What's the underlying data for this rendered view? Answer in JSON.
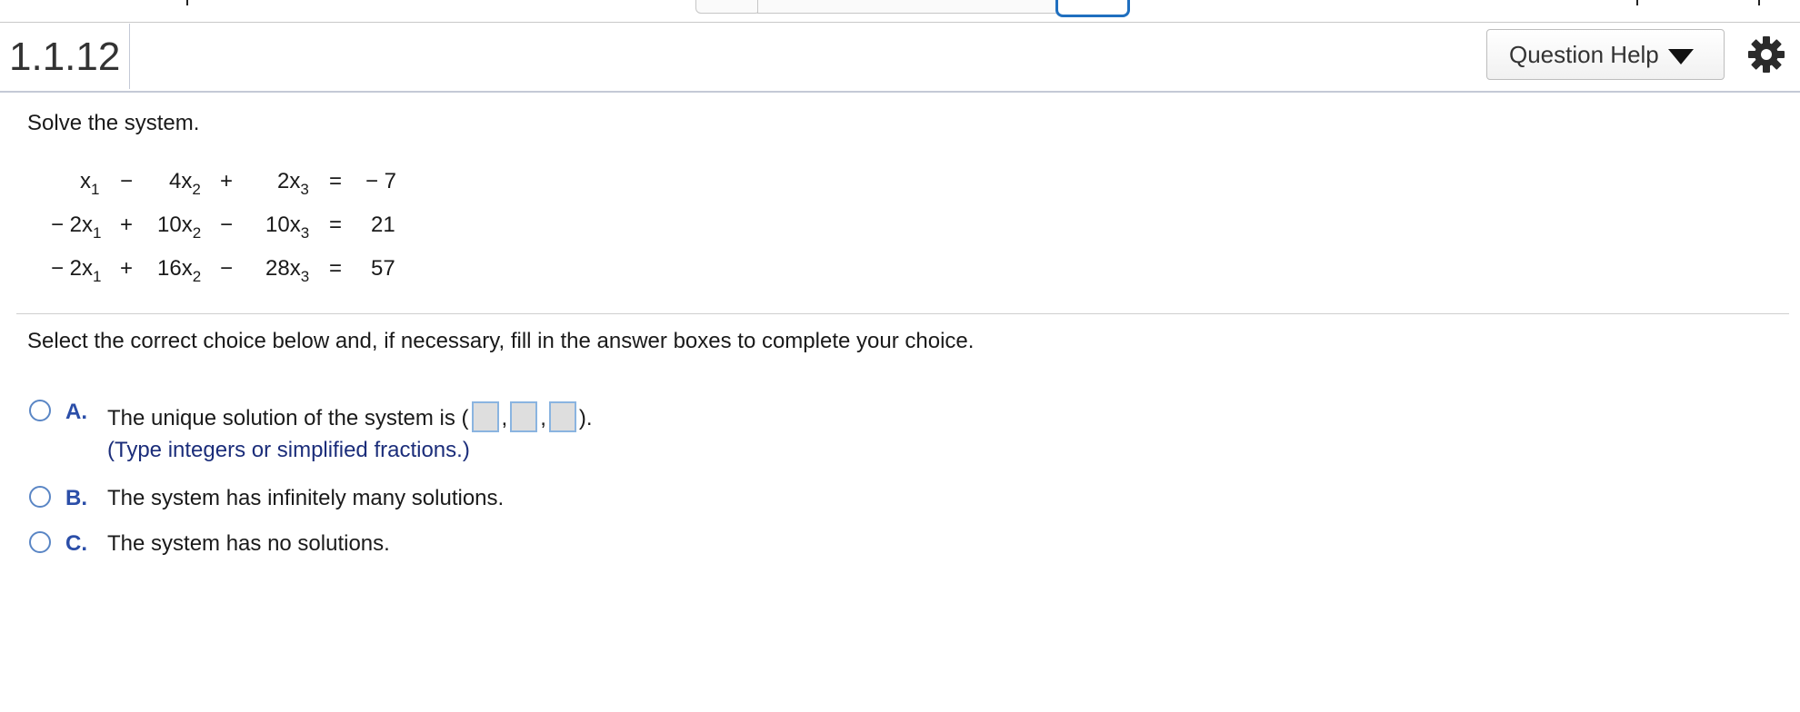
{
  "header": {
    "question_number": "1.1.12",
    "help_button_label": "Question Help"
  },
  "icons": {
    "help_arrow": "caret-down-icon",
    "settings": "gear-icon"
  },
  "problem": {
    "instruction": "Solve the system.",
    "equations": [
      {
        "t1": "x",
        "t1_sub": "1",
        "op1": "−",
        "t2": "4x",
        "t2_sub": "2",
        "op2": "+",
        "t3": "2x",
        "t3_sub": "3",
        "eq": "=",
        "rhs": "− 7"
      },
      {
        "t1": "− 2x",
        "t1_sub": "1",
        "op1": "+",
        "t2": "10x",
        "t2_sub": "2",
        "op2": "−",
        "t3": "10x",
        "t3_sub": "3",
        "eq": "=",
        "rhs": "21"
      },
      {
        "t1": "− 2x",
        "t1_sub": "1",
        "op1": "+",
        "t2": "16x",
        "t2_sub": "2",
        "op2": "−",
        "t3": "28x",
        "t3_sub": "3",
        "eq": "=",
        "rhs": "57"
      }
    ]
  },
  "choices_instruction": "Select the correct choice below and, if necessary, fill in the answer boxes to complete your choice.",
  "choices": [
    {
      "letter": "A.",
      "text_before": "The unique solution of the system is (",
      "separator": ",",
      "text_after": ").",
      "answers": [
        "",
        "",
        ""
      ],
      "hint": "(Type integers or simplified fractions.)"
    },
    {
      "letter": "B.",
      "text": "The system has infinitely many solutions."
    },
    {
      "letter": "C.",
      "text": "The system has no solutions."
    }
  ],
  "colors": {
    "choice_letter": "#2b4ea8",
    "hint_text": "#1b2d7a",
    "radio_border": "#5a86c5",
    "active_tab_border": "#1f6fbf"
  }
}
